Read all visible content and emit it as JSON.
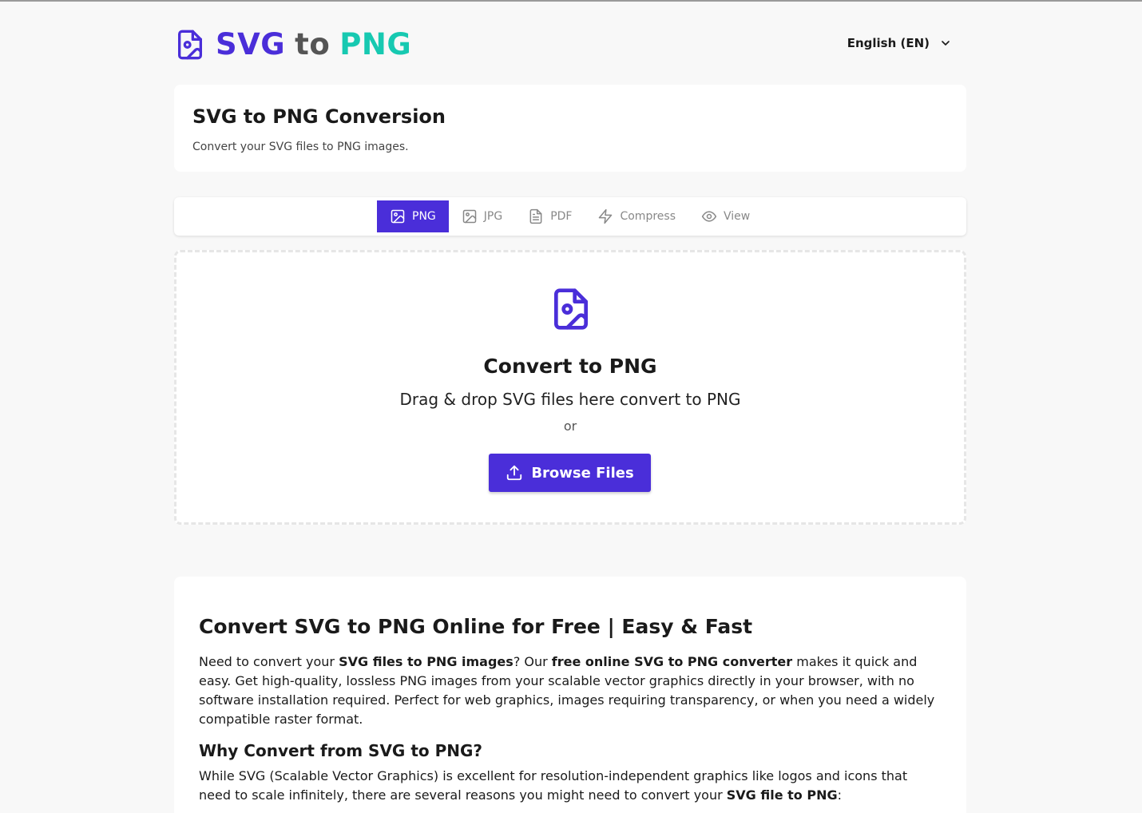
{
  "header": {
    "logo_part1": "SVG",
    "logo_part2": "to",
    "logo_part3": "PNG",
    "language": "English (EN)"
  },
  "colors": {
    "brand": "#4a2ed9",
    "accent": "#17c9b1"
  },
  "title_card": {
    "title": "SVG to PNG Conversion",
    "subtitle": "Convert your SVG files to PNG images."
  },
  "tabs": [
    {
      "label": "PNG",
      "icon": "image-icon",
      "active": true
    },
    {
      "label": "JPG",
      "icon": "image-icon",
      "active": false
    },
    {
      "label": "PDF",
      "icon": "document-icon",
      "active": false
    },
    {
      "label": "Compress",
      "icon": "lightning-icon",
      "active": false
    },
    {
      "label": "View",
      "icon": "eye-icon",
      "active": false
    }
  ],
  "dropzone": {
    "title": "Convert to PNG",
    "hint": "Drag & drop SVG files here convert to PNG",
    "or": "or",
    "browse_label": "Browse Files"
  },
  "article": {
    "heading": "Convert SVG to PNG Online for Free | Easy & Fast",
    "p1_a": "Need to convert your ",
    "p1_b": "SVG files to PNG images",
    "p1_c": "? Our ",
    "p1_d": "free online SVG to PNG converter",
    "p1_e": " makes it quick and easy. Get high-quality, lossless PNG images from your scalable vector graphics directly in your browser, with no software installation required. Perfect for web graphics, images requiring transparency, or when you need a widely compatible raster format.",
    "subheading": "Why Convert from SVG to PNG?",
    "p2_a": "While SVG (Scalable Vector Graphics) is excellent for resolution-independent graphics like logos and icons that need to scale infinitely, there are several reasons you might need to convert your ",
    "p2_b": "SVG file to PNG",
    "p2_c": ":"
  }
}
